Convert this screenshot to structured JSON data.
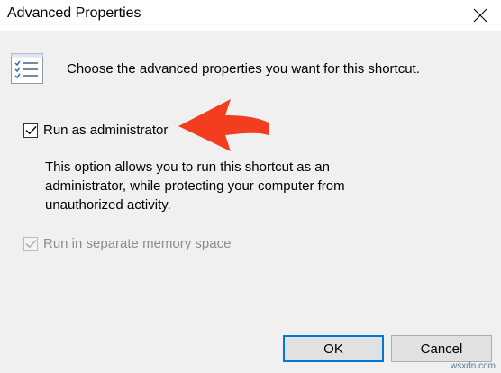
{
  "window": {
    "title": "Advanced Properties",
    "close_icon": "close-icon"
  },
  "header": {
    "icon": "checklist-icon",
    "text": "Choose the advanced properties you want for this shortcut."
  },
  "options": {
    "run_as_admin": {
      "label": "Run as administrator",
      "checked": true,
      "enabled": true
    },
    "description": "This option allows you to run this shortcut as an administrator, while protecting your computer from unauthorized activity.",
    "separate_memory": {
      "label": "Run in separate memory space",
      "checked": true,
      "enabled": false
    }
  },
  "annotation": {
    "icon": "red-arrow-icon",
    "color": "#f23d1f"
  },
  "buttons": {
    "ok": "OK",
    "cancel": "Cancel"
  },
  "watermark": "wsxdn.com",
  "colors": {
    "accent": "#0078d7",
    "background": "#f0f0f0"
  }
}
